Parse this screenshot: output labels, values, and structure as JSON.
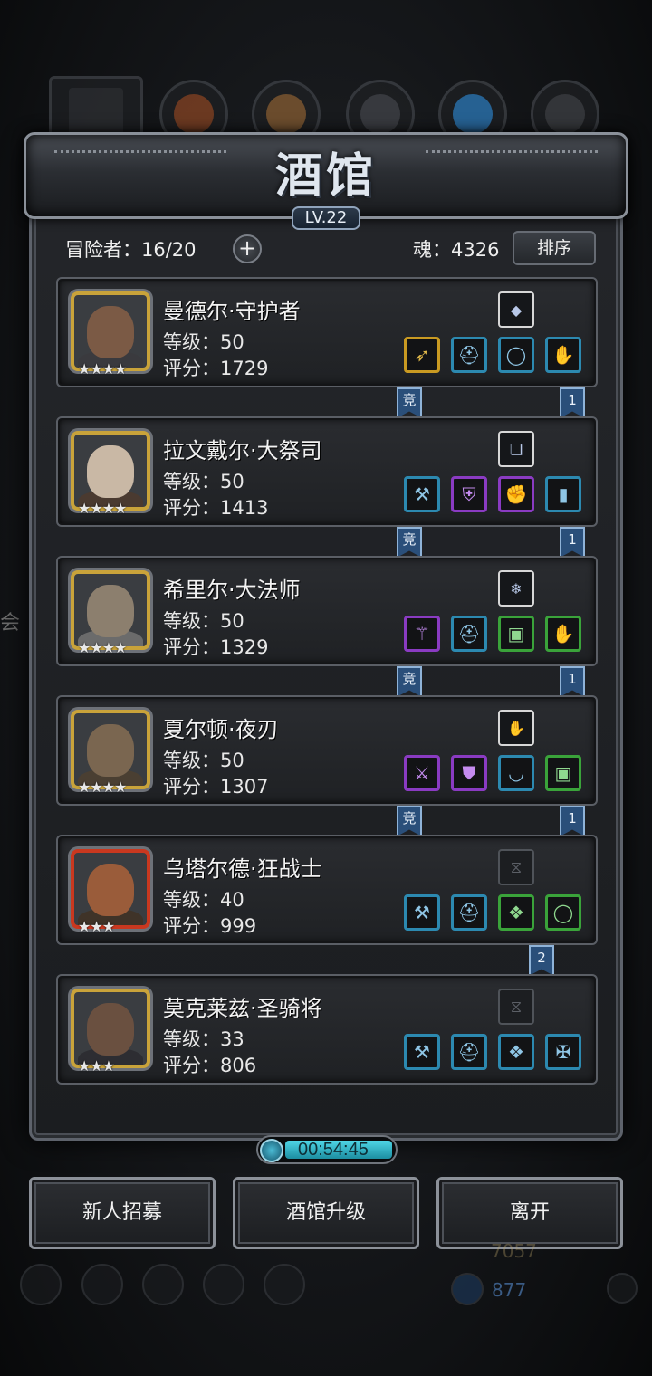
{
  "header": {
    "title": "酒馆",
    "level": "LV.22",
    "adventurers": "冒险者：16/20",
    "add_label": "+",
    "soul": "魂：4326",
    "sort_label": "排序"
  },
  "heroes": [
    {
      "name": "曼德尔·守护者",
      "level": "等级：50",
      "score": "评分：1729",
      "stars": "★★★★",
      "frame": "gold",
      "top_icon": "crystal-icon",
      "slots": [
        {
          "icon": "bow-icon",
          "rarity": "gold"
        },
        {
          "icon": "helmet-icon",
          "rarity": "blue"
        },
        {
          "icon": "ring-icon",
          "rarity": "blue"
        },
        {
          "icon": "gauntlet-icon",
          "rarity": "blue"
        }
      ],
      "banners": [
        "竞",
        "1"
      ]
    },
    {
      "name": "拉文戴尔·大祭司",
      "level": "等级：50",
      "score": "评分：1413",
      "stars": "★★★★",
      "frame": "gold",
      "top_icon": "scroll-icon",
      "slots": [
        {
          "icon": "hammer-icon",
          "rarity": "blue"
        },
        {
          "icon": "armor-icon",
          "rarity": "purple"
        },
        {
          "icon": "glove-icon",
          "rarity": "purple"
        },
        {
          "icon": "plank-icon",
          "rarity": "blue"
        }
      ],
      "banners": [
        "竞",
        "1"
      ]
    },
    {
      "name": "希里尔·大法师",
      "level": "等级：50",
      "score": "评分：1329",
      "stars": "★★★★",
      "frame": "gold",
      "top_icon": "ice-crystal-icon",
      "slots": [
        {
          "icon": "staff-icon",
          "rarity": "purple"
        },
        {
          "icon": "helmet-icon",
          "rarity": "blue"
        },
        {
          "icon": "chest-icon",
          "rarity": "green"
        },
        {
          "icon": "gauntlet-icon",
          "rarity": "green"
        }
      ],
      "banners": [
        "竞",
        "1"
      ]
    },
    {
      "name": "夏尔顿·夜刃",
      "level": "等级：50",
      "score": "评分：1307",
      "stars": "★★★★",
      "frame": "gold",
      "top_icon": "gauntlet-icon",
      "slots": [
        {
          "icon": "dagger-icon",
          "rarity": "purple"
        },
        {
          "icon": "leather-armor-icon",
          "rarity": "purple"
        },
        {
          "icon": "horn-icon",
          "rarity": "blue"
        },
        {
          "icon": "chest-icon",
          "rarity": "green"
        }
      ],
      "banners": [
        "竞",
        "1"
      ]
    },
    {
      "name": "乌塔尔德·狂战士",
      "level": "等级：40",
      "score": "评分：999",
      "stars": "★★★",
      "frame": "red",
      "top_icon": "empty-slot-icon",
      "slots": [
        {
          "icon": "axe-icon",
          "rarity": "blue"
        },
        {
          "icon": "helmet-icon",
          "rarity": "blue"
        },
        {
          "icon": "amulet-icon",
          "rarity": "green"
        },
        {
          "icon": "ring-icon",
          "rarity": "green"
        }
      ],
      "banners": [
        "2"
      ]
    },
    {
      "name": "莫克莱兹·圣骑将",
      "level": "等级：33",
      "score": "评分：806",
      "stars": "★★★",
      "frame": "gold",
      "top_icon": "empty-slot-icon",
      "slots": [
        {
          "icon": "hammer-icon",
          "rarity": "blue"
        },
        {
          "icon": "helmet-icon",
          "rarity": "blue"
        },
        {
          "icon": "amulet-icon",
          "rarity": "blue"
        },
        {
          "icon": "necklace-icon",
          "rarity": "blue"
        }
      ],
      "banners": []
    }
  ],
  "timer": "00:54:45",
  "buttons": {
    "recruit": "新人招募",
    "upgrade": "酒馆升级",
    "leave": "离开"
  },
  "background": {
    "left_text": "会",
    "currency": "877",
    "gold_partial": "7057"
  }
}
